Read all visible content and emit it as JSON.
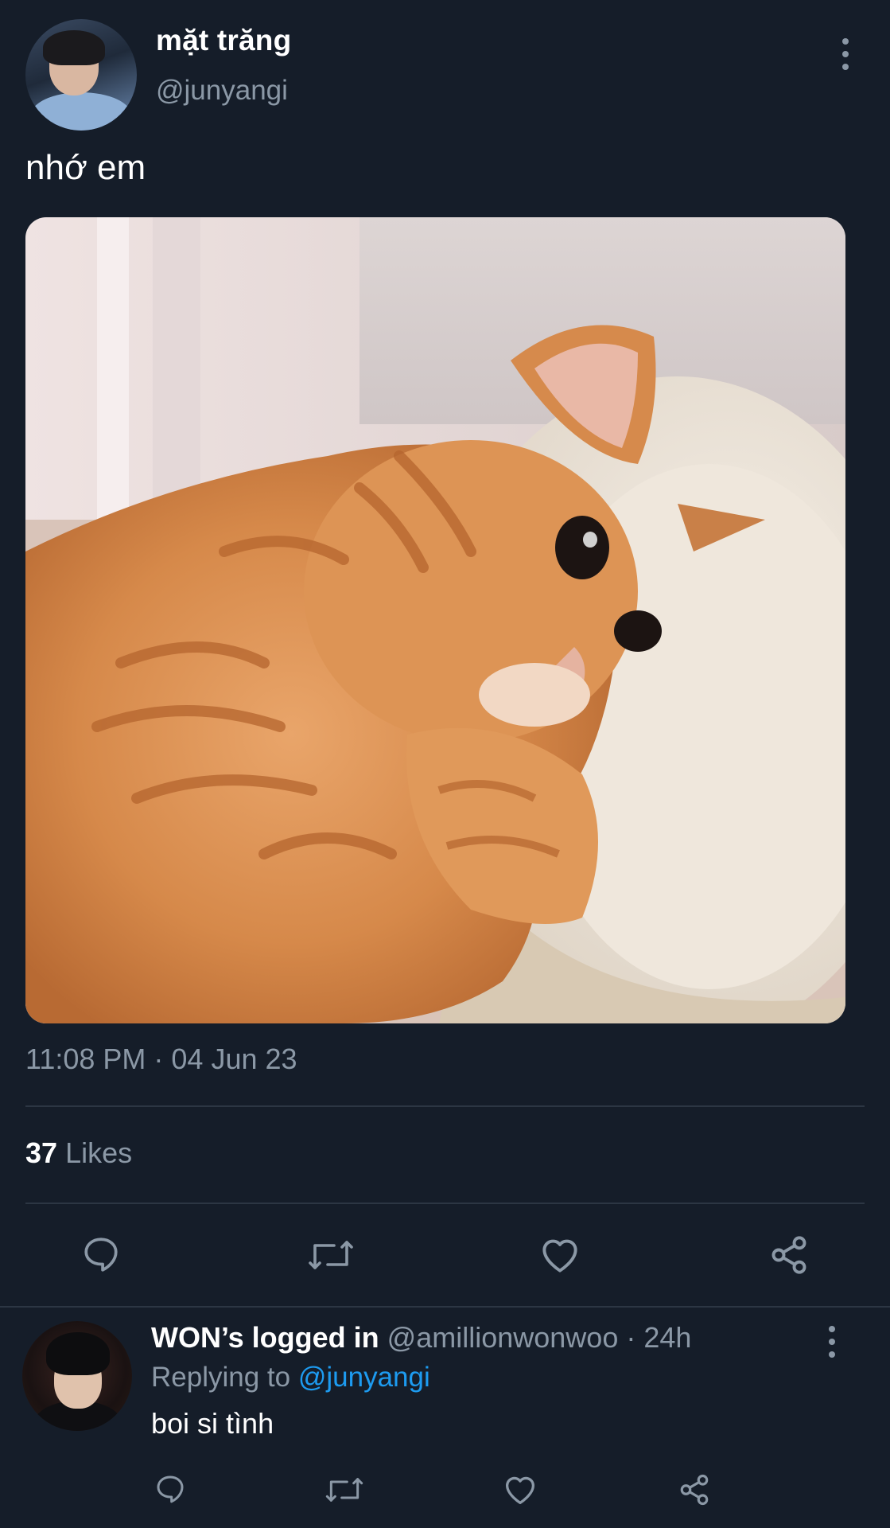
{
  "tweet": {
    "author": {
      "display_name": "mặt trăng",
      "handle": "@junyangi"
    },
    "text": "nhớ em",
    "timestamp": "11:08 PM · 04 Jun 23",
    "likes": {
      "count": "37",
      "label": "Likes"
    },
    "actions": [
      "reply-icon",
      "retweet-icon",
      "like-icon",
      "share-icon"
    ]
  },
  "reply": {
    "author": {
      "display_name": "WON’s logged in",
      "handle": "@amillionwonwoo",
      "separator": " · ",
      "time": "24h"
    },
    "replying_to_label": "Replying to",
    "replying_to_handle": "@junyangi",
    "text": "boi si tình",
    "actions": [
      "reply-icon",
      "retweet-icon",
      "like-icon",
      "share-icon"
    ]
  },
  "colors": {
    "background": "#151d29",
    "text_primary": "#ffffff",
    "text_secondary": "#8b98a6",
    "link": "#1d9bf0",
    "divider": "#2c3643"
  }
}
